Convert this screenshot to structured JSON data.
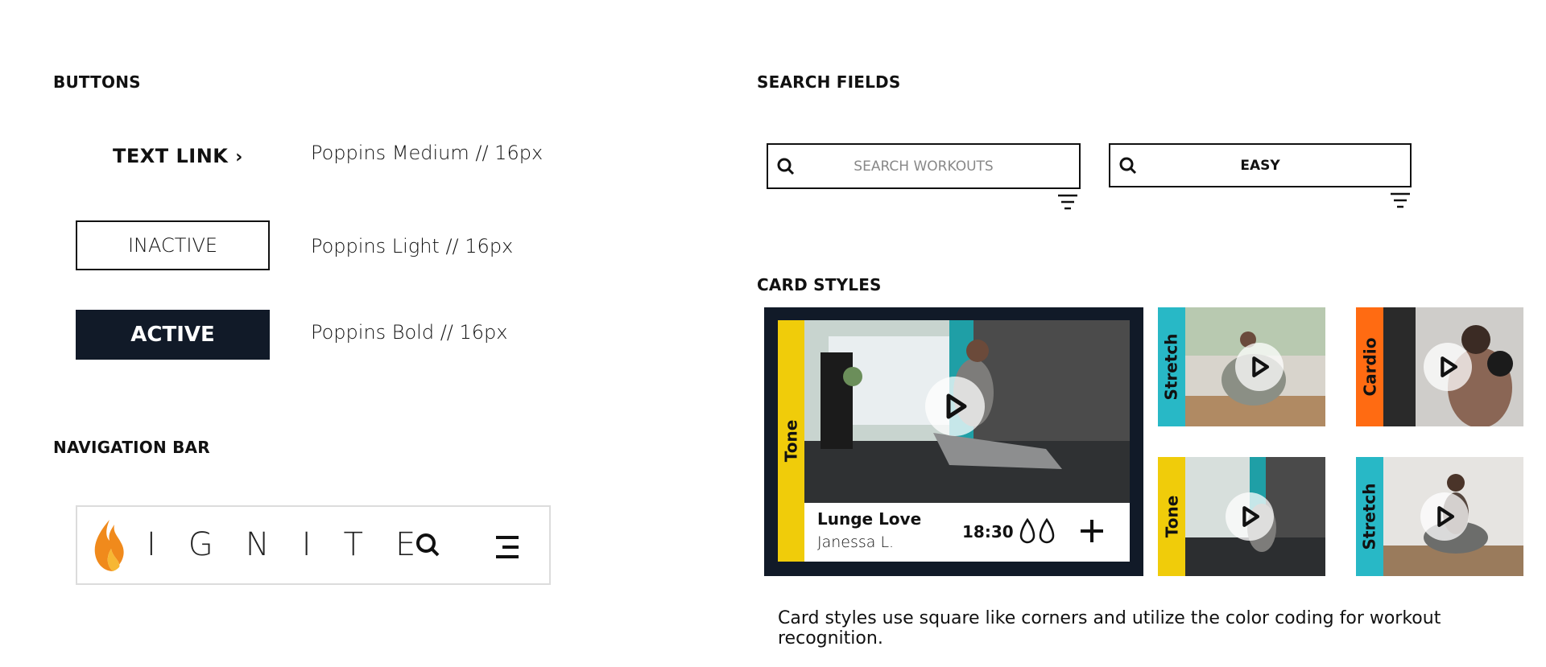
{
  "colors": {
    "navy": "#111a28",
    "tone_yellow": "#f0cc0a",
    "stretch_teal": "#28b8c6",
    "cardio_orange": "#ff6b12",
    "border": "#111111"
  },
  "sections": {
    "buttons": "BUTTONS",
    "search_fields": "SEARCH FIELDS",
    "navigation_bar": "NAVIGATION BAR",
    "card_styles": "CARD STYLES"
  },
  "buttons": {
    "text_link": {
      "label": "TEXT LINK",
      "icon": "chevron-right-icon",
      "spec": "Poppins Medium // 16px"
    },
    "inactive": {
      "label": "INACTIVE",
      "spec": "Poppins Light // 16px"
    },
    "active": {
      "label": "ACTIVE",
      "spec": "Poppins Bold // 16px"
    }
  },
  "navbar": {
    "logo_icon": "flame-icon",
    "brand": "IGNITE",
    "search_icon": "search-icon",
    "menu_icon": "menu-icon"
  },
  "search_fields": [
    {
      "placeholder": "SEARCH WORKOUTS",
      "value": "",
      "icon": "search-icon",
      "filter_icon": "filter-icon"
    },
    {
      "placeholder": "",
      "value": "EASY",
      "icon": "search-icon",
      "filter_icon": "filter-icon"
    }
  ],
  "cards": {
    "featured": {
      "category": "Tone",
      "title": "Lunge Love",
      "instructor": "Janessa L.",
      "duration": "18:30",
      "intensity_icon": "droplet-icon",
      "intensity_level": 2,
      "add_icon": "plus-icon",
      "play_icon": "play-icon"
    },
    "small": [
      {
        "category": "Stretch",
        "color": "#28b8c6",
        "play_icon": "play-icon"
      },
      {
        "category": "Cardio",
        "color": "#ff6b12",
        "play_icon": "play-icon"
      },
      {
        "category": "Tone",
        "color": "#f0cc0a",
        "play_icon": "play-icon"
      },
      {
        "category": "Stretch",
        "color": "#28b8c6",
        "play_icon": "play-icon"
      }
    ]
  },
  "caption": "Card styles use square like corners and utilize the color coding for workout recognition."
}
